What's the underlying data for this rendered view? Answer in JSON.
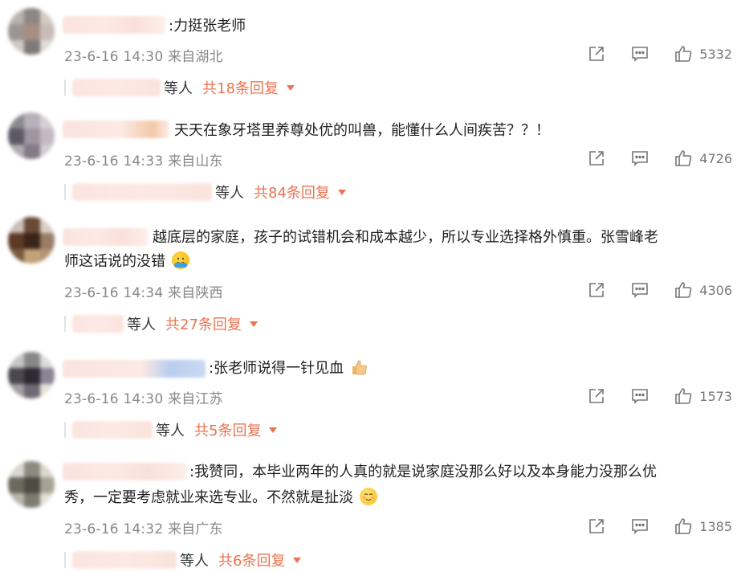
{
  "comments": [
    {
      "text": ":力挺张老师",
      "time": "23-6-16 14:30",
      "location": "来自湖北",
      "likes": "5332",
      "reply_suffix": "等人",
      "reply_total": "共18条回复"
    },
    {
      "text": "天天在象牙塔里养尊处优的叫兽，能懂什么人间疾苦？？！",
      "time": "23-6-16 14:33",
      "location": "来自山东",
      "likes": "4726",
      "reply_suffix": "等人",
      "reply_total": "共84条回复"
    },
    {
      "text_line1": "越底层的家庭，孩子的试错机会和成本越少，所以专业选择格外慎重。张雪峰老",
      "text_line2": "师这话说的没错",
      "emoji": "hugging-face-emoji",
      "time": "23-6-16 14:34",
      "location": "来自陕西",
      "likes": "4306",
      "reply_suffix": "等人",
      "reply_total": "共27条回复"
    },
    {
      "text": ":张老师说得一针见血",
      "emoji": "thumbs-up-emoji",
      "time": "23-6-16 14:30",
      "location": "来自江苏",
      "likes": "1573",
      "reply_suffix": "等人",
      "reply_total": "共5条回复"
    },
    {
      "text_line1": ":我赞同，本毕业两年的人真的就是说家庭没那么好以及本身能力没那么优",
      "text_line2": "秀，一定要考虑就业来选专业。不然就是扯淡",
      "emoji": "grinning-blush-emoji",
      "time": "23-6-16 14:32",
      "location": "来自广东",
      "likes": "1385",
      "reply_suffix": "等人",
      "reply_total": "共6条回复"
    }
  ],
  "icons": {
    "share": "share-icon",
    "comment": "comment-icon",
    "like": "like-icon",
    "expand": "caret-down-icon"
  },
  "colors": {
    "accent": "#eb7350",
    "meta": "#888888",
    "text": "#1f1f1f"
  }
}
